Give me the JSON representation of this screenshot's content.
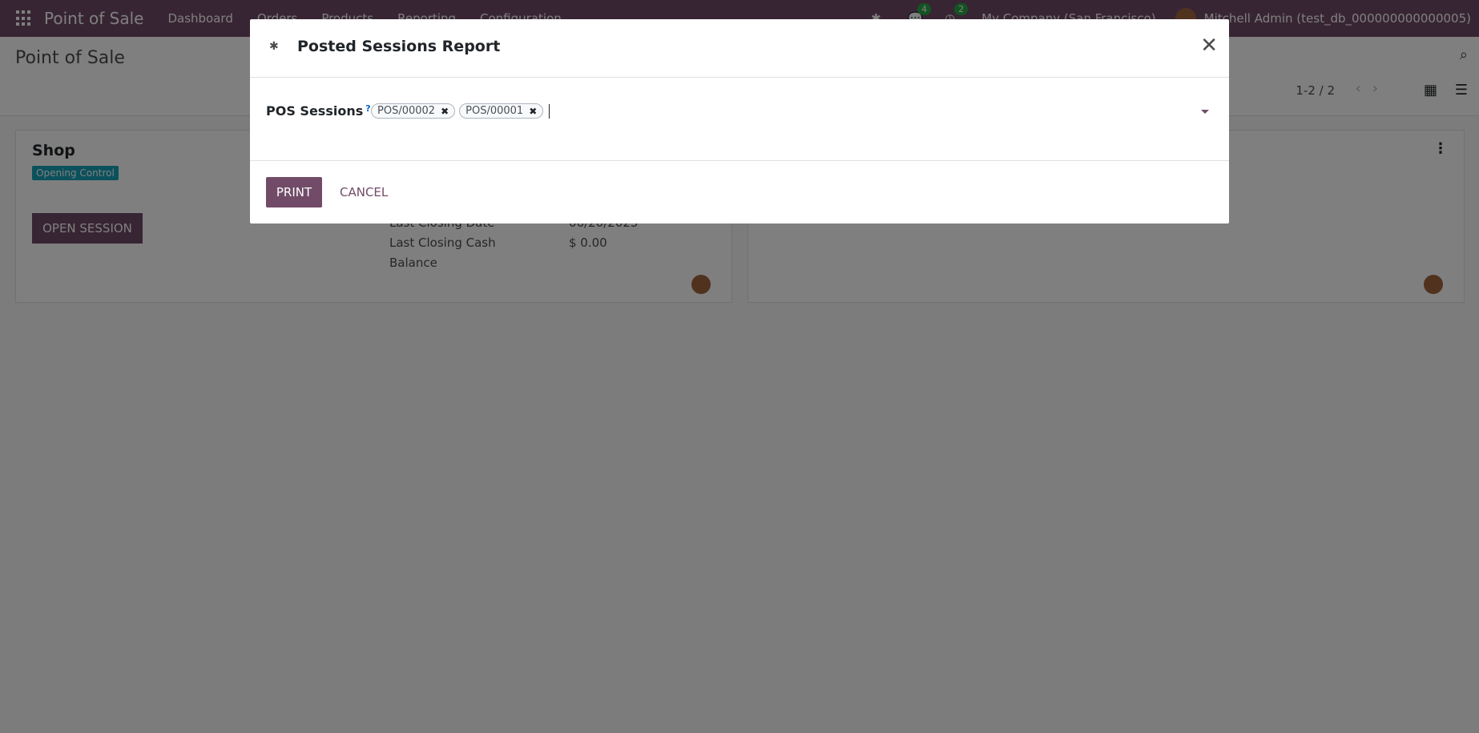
{
  "navbar": {
    "brand": "Point of Sale",
    "menu": [
      "Dashboard",
      "Orders",
      "Products",
      "Reporting",
      "Configuration"
    ],
    "messages_count": "4",
    "activities_count": "2",
    "company": "My Company (San Francisco)",
    "user": "Mitchell Admin (test_db_000000000000005)"
  },
  "control": {
    "title": "Point of Sale",
    "pager": "1-2 / 2"
  },
  "cards": [
    {
      "title": "Shop",
      "status": "Opening Control",
      "button": "OPEN SESSION",
      "closing_date_label": "Last Closing Date",
      "closing_date_value": "06/20/2023",
      "closing_cash_label": "Last Closing Cash",
      "closing_cash_label2": "Balance",
      "closing_cash_value": "$ 0.00"
    }
  ],
  "modal": {
    "title": "Posted Sessions Report",
    "field_label": "POS Sessions",
    "help": "?",
    "tags": [
      "POS/00002",
      "POS/00001"
    ],
    "print_label": "PRINT",
    "cancel_label": "CANCEL"
  },
  "colors": {
    "brand": "#714b67",
    "status_badge": "#17a2b8",
    "counter_badge": "#28a745"
  },
  "icons": [
    "apps-grid-icon",
    "bug-icon",
    "chat-icon",
    "clock-icon",
    "search-icon",
    "kanban-view-icon",
    "list-view-icon",
    "close-icon",
    "remove-tag-icon",
    "dropdown-caret-icon",
    "kebab-menu-icon"
  ]
}
